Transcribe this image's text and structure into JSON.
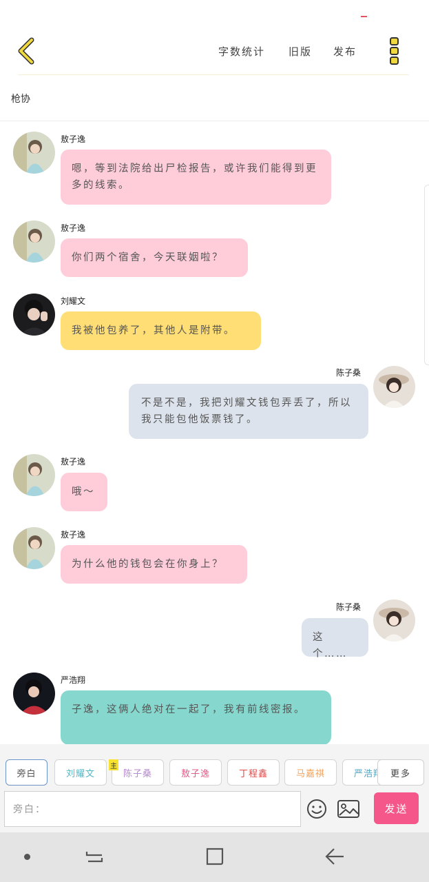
{
  "header": {
    "word_count": "字数统计",
    "old_version": "旧版",
    "publish": "发布"
  },
  "page_title": "枪协",
  "messages": [
    {
      "sender": "敖子逸",
      "text": "嗯，等到法院给出尸检报告，或许我们能得到更多的线索。"
    },
    {
      "sender": "敖子逸",
      "text": "你们两个宿舍，今天联姻啦？"
    },
    {
      "sender": "刘耀文",
      "text": "我被他包养了，其他人是附带。"
    },
    {
      "sender": "陈子桑",
      "text": "不是不是，我把刘耀文钱包弄丢了，所以我只能包他饭票钱了。"
    },
    {
      "sender": "敖子逸",
      "text": "哦～"
    },
    {
      "sender": "敖子逸",
      "text": "为什么他的钱包会在你身上？"
    },
    {
      "sender": "陈子桑",
      "text": "这个……"
    },
    {
      "sender": "严浩翔",
      "text": "子逸，这俩人绝对在一起了，我有前线密报。"
    }
  ],
  "roles": [
    "旁白",
    "刘耀文",
    "陈子桑",
    "敖子逸",
    "丁程鑫",
    "马嘉祺",
    "严浩翔"
  ],
  "lead_badge": "主",
  "more_roles": "更多",
  "input": {
    "placeholder": "旁白："
  },
  "send_label": "发送",
  "colors": {
    "pink_bubble": "#ffccda",
    "yellow_bubble": "#ffde75",
    "gray_bubble": "#dde3ec",
    "teal_bubble": "#86d8ce",
    "send_button": "#f5578a",
    "back_arrow": "#f0d840"
  },
  "icons": {
    "back": "chevron-left-icon",
    "more": "more-vertical-icon",
    "emoji": "smiley-icon",
    "image": "image-icon"
  }
}
